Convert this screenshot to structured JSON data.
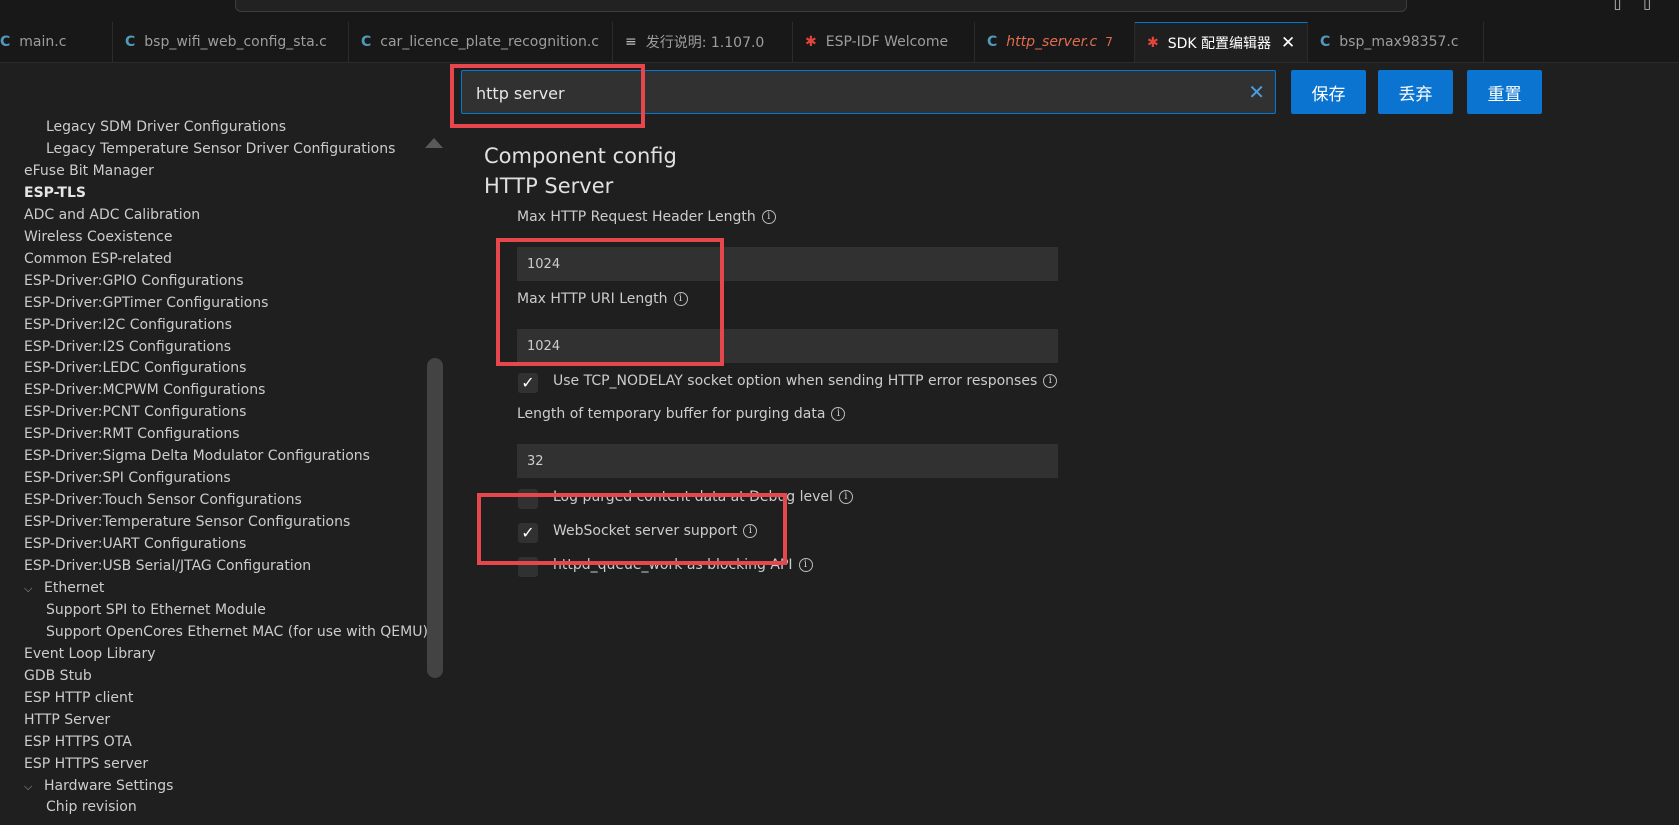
{
  "tabs": [
    {
      "label": "main.c",
      "icon": "c-file-icon",
      "kind": "c"
    },
    {
      "label": "bsp_wifi_web_config_sta.c",
      "icon": "c-file-icon",
      "kind": "c"
    },
    {
      "label": "car_licence_plate_recognition.c",
      "icon": "c-file-icon",
      "kind": "c"
    },
    {
      "label": "发行说明: 1.107.0",
      "icon": "document-icon",
      "kind": "doc"
    },
    {
      "label": "ESP-IDF Welcome",
      "icon": "espressif-icon",
      "kind": "esp"
    },
    {
      "label": "http_server.c",
      "badge": "7",
      "icon": "c-file-icon",
      "kind": "c"
    },
    {
      "label": "SDK 配置编辑器",
      "icon": "espressif-icon",
      "kind": "esp",
      "active": true
    },
    {
      "label": "bsp_max98357.c",
      "icon": "c-file-icon",
      "kind": "c"
    }
  ],
  "search": {
    "value": "http server"
  },
  "buttons": {
    "save": "保存",
    "discard": "丢弃",
    "reset": "重置"
  },
  "sidebar": [
    {
      "label": "Legacy SDM Driver Configurations",
      "indent": 1
    },
    {
      "label": "Legacy Temperature Sensor Driver Configurations",
      "indent": 1
    },
    {
      "label": "eFuse Bit Manager",
      "indent": 0
    },
    {
      "label": "ESP-TLS",
      "indent": 0,
      "bold": true
    },
    {
      "label": "ADC and ADC Calibration",
      "indent": 0
    },
    {
      "label": "Wireless Coexistence",
      "indent": 0
    },
    {
      "label": "Common ESP-related",
      "indent": 0
    },
    {
      "label": "ESP-Driver:GPIO Configurations",
      "indent": 0
    },
    {
      "label": "ESP-Driver:GPTimer Configurations",
      "indent": 0
    },
    {
      "label": "ESP-Driver:I2C Configurations",
      "indent": 0
    },
    {
      "label": "ESP-Driver:I2S Configurations",
      "indent": 0
    },
    {
      "label": "ESP-Driver:LEDC Configurations",
      "indent": 0
    },
    {
      "label": "ESP-Driver:MCPWM Configurations",
      "indent": 0
    },
    {
      "label": "ESP-Driver:PCNT Configurations",
      "indent": 0
    },
    {
      "label": "ESP-Driver:RMT Configurations",
      "indent": 0
    },
    {
      "label": "ESP-Driver:Sigma Delta Modulator Configurations",
      "indent": 0
    },
    {
      "label": "ESP-Driver:SPI Configurations",
      "indent": 0
    },
    {
      "label": "ESP-Driver:Touch Sensor Configurations",
      "indent": 0
    },
    {
      "label": "ESP-Driver:Temperature Sensor Configurations",
      "indent": 0
    },
    {
      "label": "ESP-Driver:UART Configurations",
      "indent": 0
    },
    {
      "label": "ESP-Driver:USB Serial/JTAG Configuration",
      "indent": 0
    },
    {
      "label": "Ethernet",
      "indent": 0,
      "expanded": true
    },
    {
      "label": "Support SPI to Ethernet Module",
      "indent": 1
    },
    {
      "label": "Support OpenCores Ethernet MAC (for use with QEMU)",
      "indent": 1
    },
    {
      "label": "Event Loop Library",
      "indent": 0
    },
    {
      "label": "GDB Stub",
      "indent": 0
    },
    {
      "label": "ESP HTTP client",
      "indent": 0
    },
    {
      "label": "HTTP Server",
      "indent": 0
    },
    {
      "label": "ESP HTTPS OTA",
      "indent": 0
    },
    {
      "label": "ESP HTTPS server",
      "indent": 0
    },
    {
      "label": "Hardware Settings",
      "indent": 0,
      "expanded": true
    },
    {
      "label": "Chip revision",
      "indent": 1
    }
  ],
  "main": {
    "breadcrumb": "Component config",
    "section": "HTTP Server",
    "max_header_label": "Max HTTP Request Header Length",
    "max_header_value": "1024",
    "max_uri_label": "Max HTTP URI Length",
    "max_uri_value": "1024",
    "nodelay_label": "Use TCP_NODELAY socket option when sending HTTP error responses",
    "nodelay_checked": true,
    "purge_label": "Length of temporary buffer for purging data",
    "purge_value": "32",
    "log_purged_label": "Log purged content data at Debug level",
    "log_purged_checked": false,
    "websocket_label": "WebSocket server support",
    "websocket_checked": true,
    "queue_work_label": "httpd_queue_work as blocking API",
    "queue_work_checked": false,
    "info_glyph": "i",
    "check_glyph": "✓"
  },
  "colors": {
    "accent": "#0078d4",
    "highlight": "#e5474d",
    "background": "#1f1f1f"
  }
}
